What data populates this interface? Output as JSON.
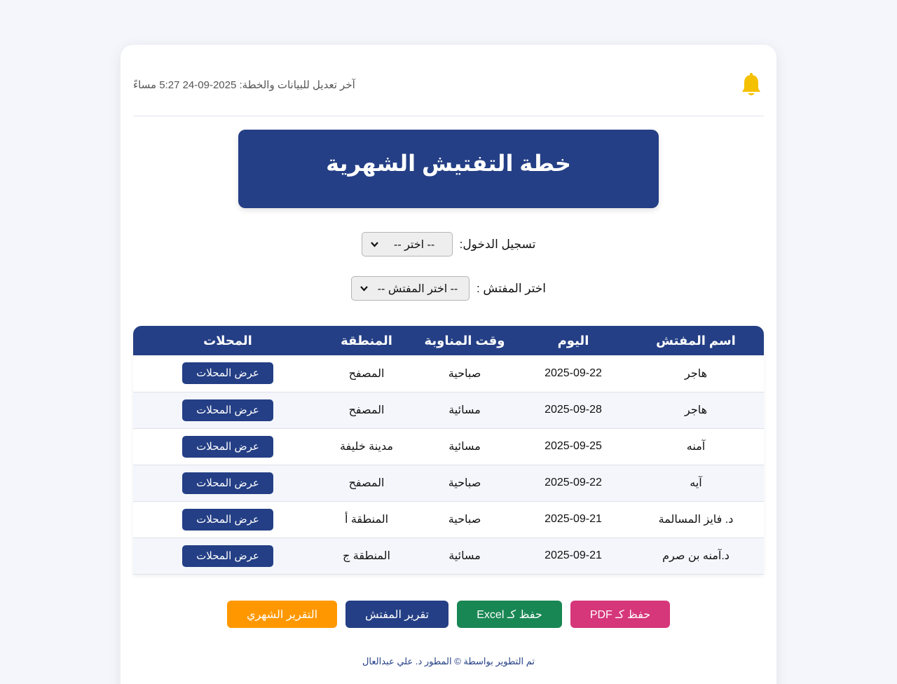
{
  "header": {
    "last_edit": "آخر تعديل للبيانات والخطة: 2025-09-24 5:27 مساءً",
    "bell_icon": "bell-icon",
    "bell_color": "#f5c000"
  },
  "title": "خطة التفتيش الشهرية",
  "login": {
    "label": "تسجيل الدخول:",
    "selected": "-- اختر --"
  },
  "inspector_select": {
    "label": "اختر المفتش :",
    "selected": "-- اختر المفتش --"
  },
  "table": {
    "headers": [
      "اسم المفتش",
      "اليوم",
      "وقت المناوبة",
      "المنطقة",
      "المحلات"
    ],
    "rows": [
      {
        "name": "هاجر",
        "day": "2025-09-22",
        "shift": "صباحية",
        "area": "المصفح",
        "action": "عرض المحلات"
      },
      {
        "name": "هاجر",
        "day": "2025-09-28",
        "shift": "مسائية",
        "area": "المصفح",
        "action": "عرض المحلات"
      },
      {
        "name": "آمنه",
        "day": "2025-09-25",
        "shift": "مسائية",
        "area": "مدينة خليفة",
        "action": "عرض المحلات"
      },
      {
        "name": "آيه",
        "day": "2025-09-22",
        "shift": "صباحية",
        "area": "المصفح",
        "action": "عرض المحلات"
      },
      {
        "name": "د. فايز المسالمة",
        "day": "2025-09-21",
        "shift": "صباحية",
        "area": "المنطقة أ",
        "action": "عرض المحلات"
      },
      {
        "name": "د.آمنه بن صرم",
        "day": "2025-09-21",
        "shift": "مسائية",
        "area": "المنطقة ج",
        "action": "عرض المحلات"
      }
    ]
  },
  "actions": {
    "pdf": "حفظ كـ PDF",
    "excel": "حفظ كـ Excel",
    "inspector_report": "تقرير المفتش",
    "monthly_report": "التقرير الشهري"
  },
  "footer": "تم التطوير بواسطة © المطور د. علي عبدالعال",
  "colors": {
    "primary": "#243f85",
    "pdf": "#d6367a",
    "excel": "#198754",
    "monthly": "#ff9800"
  }
}
